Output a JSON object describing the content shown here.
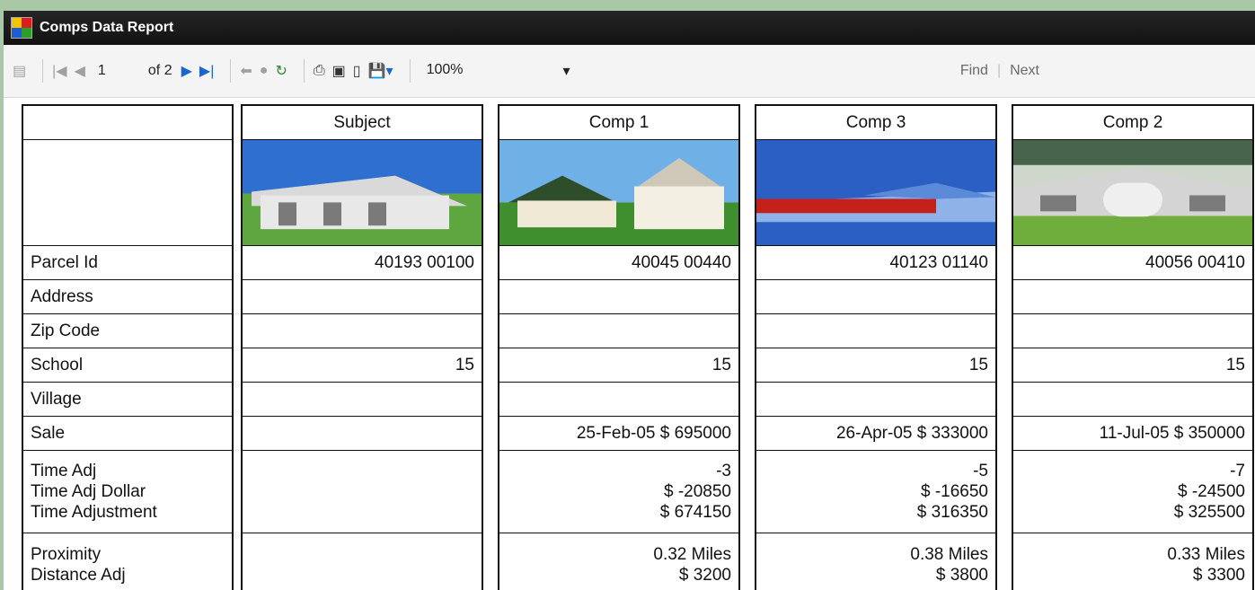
{
  "window": {
    "title": "Comps Data Report",
    "icon": "report-app-icon"
  },
  "toolbar": {
    "page": "1",
    "of_label": "of 2",
    "zoom": "100%",
    "find": "Find",
    "next": "Next",
    "icons": [
      "document-map-icon",
      "first-page-icon",
      "prev-page-icon",
      "next-page-icon",
      "last-page-icon",
      "back-icon",
      "stop-icon",
      "refresh-icon",
      "print-icon",
      "print-layout-icon",
      "page-setup-icon",
      "export-icon"
    ]
  },
  "labels": {
    "parcel": "Parcel Id",
    "address": "Address",
    "zip": "Zip Code",
    "school": "School",
    "village": "Village",
    "sale": "Sale",
    "time_adj": "Time Adj",
    "time_adj_dollar": "Time Adj Dollar",
    "time_adjustment": "Time Adjustment",
    "proximity": "Proximity",
    "distance_adj": "Distance Adj"
  },
  "columns": [
    {
      "header": "Subject",
      "parcel": "40193  00100",
      "school": "15",
      "sale": "",
      "time_adj": "",
      "time_adj_dollar": "",
      "time_adjustment": "",
      "proximity": "",
      "distance_adj": ""
    },
    {
      "header": "Comp 1",
      "parcel": "40045  00440",
      "school": "15",
      "sale": "25-Feb-05 $  695000",
      "time_adj": "-3",
      "time_adj_dollar": "$ -20850",
      "time_adjustment": "$ 674150",
      "proximity": "0.32 Miles",
      "distance_adj": "$ 3200"
    },
    {
      "header": "Comp 3",
      "parcel": "40123  01140",
      "school": "15",
      "sale": "26-Apr-05 $  333000",
      "time_adj": "-5",
      "time_adj_dollar": "$ -16650",
      "time_adjustment": "$ 316350",
      "proximity": "0.38 Miles",
      "distance_adj": "$ 3800"
    },
    {
      "header": "Comp 2",
      "parcel": "40056  00410",
      "school": "15",
      "sale": "11-Jul-05 $  350000",
      "time_adj": "-7",
      "time_adj_dollar": "$ -24500",
      "time_adjustment": "$ 325500",
      "proximity": "0.33 Miles",
      "distance_adj": "$ 3300"
    }
  ]
}
